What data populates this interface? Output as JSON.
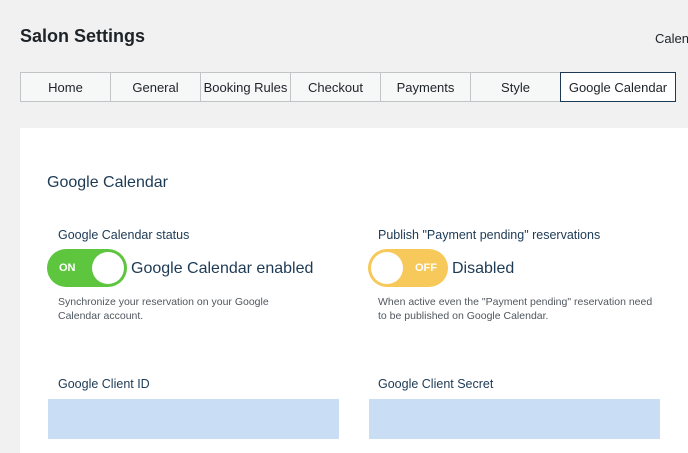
{
  "page": {
    "title": "Salon Settings",
    "top_link": "Calendar"
  },
  "tabs": [
    {
      "label": "Home"
    },
    {
      "label": "General"
    },
    {
      "label": "Booking Rules"
    },
    {
      "label": "Checkout"
    },
    {
      "label": "Payments"
    },
    {
      "label": "Style"
    },
    {
      "label": "Google Calendar",
      "active": true
    }
  ],
  "section": {
    "title": "Google Calendar"
  },
  "status": {
    "label": "Google Calendar status",
    "toggle_state": "ON",
    "toggle_text": "Google Calendar enabled",
    "help": "Synchronize your reservation on your Google Calendar account."
  },
  "publish": {
    "label": "Publish \"Payment pending\" reservations",
    "toggle_state": "OFF",
    "toggle_text": "Disabled",
    "help": "When active even the \"Payment pending\" reservation need to be published on Google Calendar."
  },
  "client_id": {
    "label": "Google Client ID",
    "value": ""
  },
  "client_secret": {
    "label": "Google Client Secret",
    "value": ""
  },
  "colors": {
    "toggle_on": "#5ec53e",
    "toggle_off": "#f7c85a",
    "input_bg": "#c9def4",
    "accent_text": "#1d3a55"
  }
}
